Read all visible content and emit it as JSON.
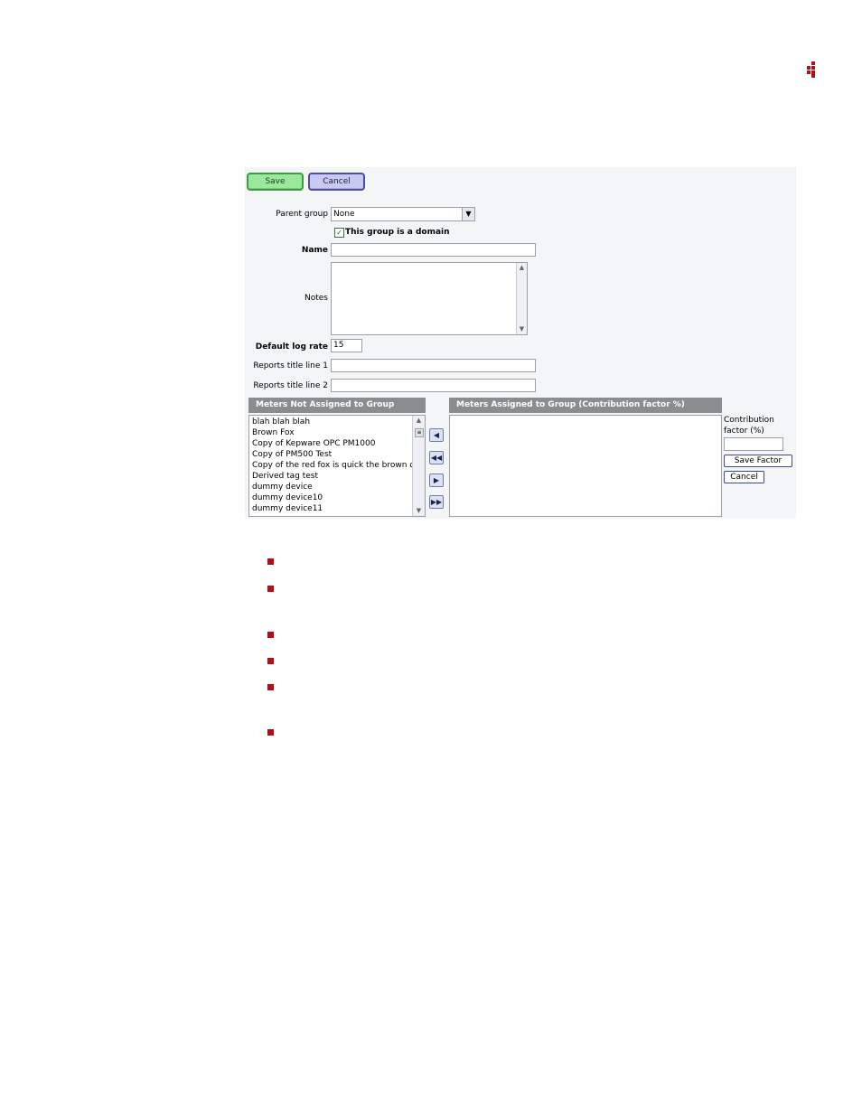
{
  "colors": {
    "accent_red": "#b10f14",
    "save_green": "#9be79c",
    "cancel_blue": "#c9caf2",
    "header_gray": "#8b8c8e"
  },
  "icons": {
    "logo": "dots-logo-icon",
    "bullet": "square-bullet-icon"
  },
  "toolbar": {
    "save_label": "Save",
    "cancel_label": "Cancel"
  },
  "form": {
    "parent_group_label": "Parent group",
    "parent_group_value": "None",
    "domain_checkbox_label": "This group is a domain",
    "domain_checked": true,
    "name_label": "Name",
    "name_value": "",
    "notes_label": "Notes",
    "notes_value": "",
    "default_log_rate_label": "Default log rate",
    "default_log_rate_value": "15",
    "reports_title_1_label": "Reports title line 1",
    "reports_title_1_value": "",
    "reports_title_2_label": "Reports title line 2",
    "reports_title_2_value": ""
  },
  "meters": {
    "unassigned_header": "Meters Not Assigned to Group",
    "assigned_header": "Meters Assigned to Group (Contribution factor %)",
    "unassigned": [
      "blah blah blah",
      "Brown Fox",
      "Copy of Kepware OPC PM1000",
      "Copy of PM500 Test",
      "Copy of the red fox is quick the brown do",
      "Derived tag test",
      "dummy device",
      "dummy device10",
      "dummy device11"
    ],
    "assigned": [],
    "contribution_label": "Contribution factor (%)",
    "contribution_value": "",
    "save_factor_label": "Save Factor",
    "cancel_label": "Cancel"
  }
}
